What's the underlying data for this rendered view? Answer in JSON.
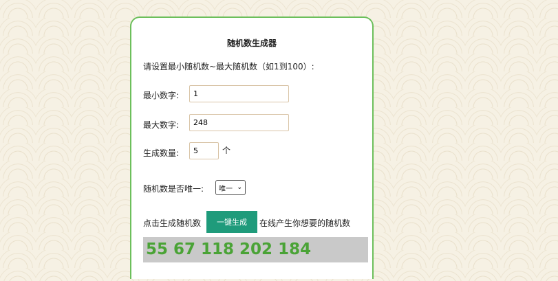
{
  "app": {
    "title": "随机数生成器",
    "prompt": "请设置最小随机数~最大随机数（如1到100）:"
  },
  "form": {
    "min_label": "最小数字:",
    "min_value": "1",
    "max_label": "最大数字:",
    "max_value": "248",
    "count_label": "生成数量:",
    "count_value": "5",
    "count_unit": "个",
    "unique_label": "随机数是否唯一:",
    "unique_selected": "唯一"
  },
  "action": {
    "prefix": "点击生成随机数",
    "button_label": "一键生成",
    "suffix": "在线产生你想要的随机数"
  },
  "result": {
    "text": "55 67 118 202 184"
  },
  "colors": {
    "card_border": "#6cbf5b",
    "button_bg": "#1f9b7b",
    "result_text": "#4aa336",
    "result_bg": "#c9c9c9"
  },
  "icons": {
    "select_arrow": "chevron-down-icon"
  }
}
